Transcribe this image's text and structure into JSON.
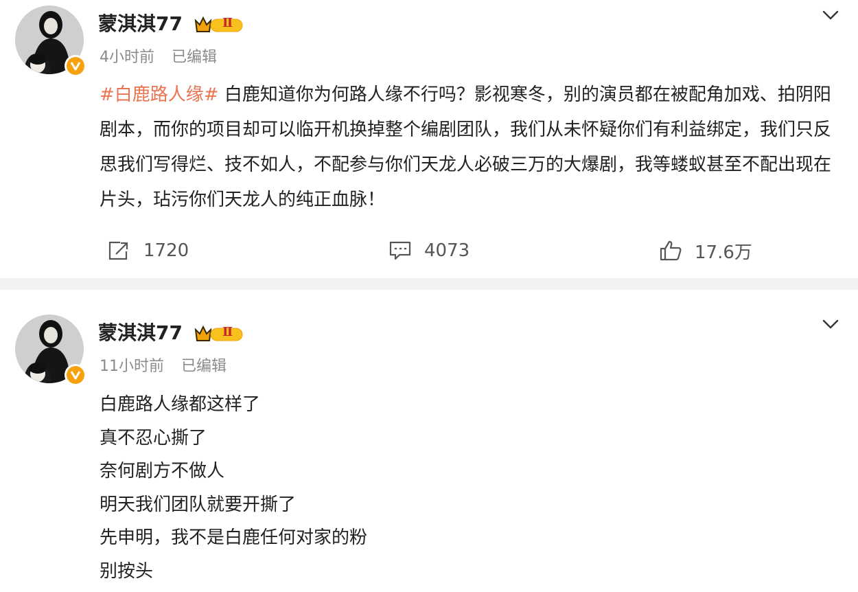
{
  "posts": [
    {
      "username": "蒙淇淇77",
      "badge": "Ⅱ",
      "time": "4小时前",
      "edited": "已编辑",
      "topic": "#白鹿路人缘#",
      "text": " 白鹿知道你为何路人缘不行吗？影视寒冬，别的演员都在被配角加戏、拍阴阳剧本，而你的项目却可以临开机换掉整个编剧团队，我们从未怀疑你们有利益绑定，我们只反思我们写得烂、技不如人，不配参与你们天龙人必破三万的大爆剧，我等蝼蚁甚至不配出现在片头，玷污你们天龙人的纯正血脉！",
      "shares": "1720",
      "comments": "4073",
      "likes": "17.6万"
    },
    {
      "username": "蒙淇淇77",
      "badge": "Ⅱ",
      "time": "11小时前",
      "edited": "已编辑",
      "lines": [
        "白鹿路人缘都这样了",
        "真不忍心撕了",
        "奈何剧方不做人",
        "明天我们团队就要开撕了",
        "先申明，我不是白鹿任何对家的粉",
        "别按头"
      ]
    }
  ],
  "icons": {
    "share": "share-icon",
    "comment": "comment-icon",
    "like": "like-icon",
    "menu": "chevron-down-icon",
    "verified": "verified-v-icon",
    "badge": "crown-level-badge"
  },
  "colors": {
    "topic": "#eb7350",
    "meta": "#8a8a8a",
    "badge": "#f7a10c",
    "separator": "#f2f2f2"
  }
}
